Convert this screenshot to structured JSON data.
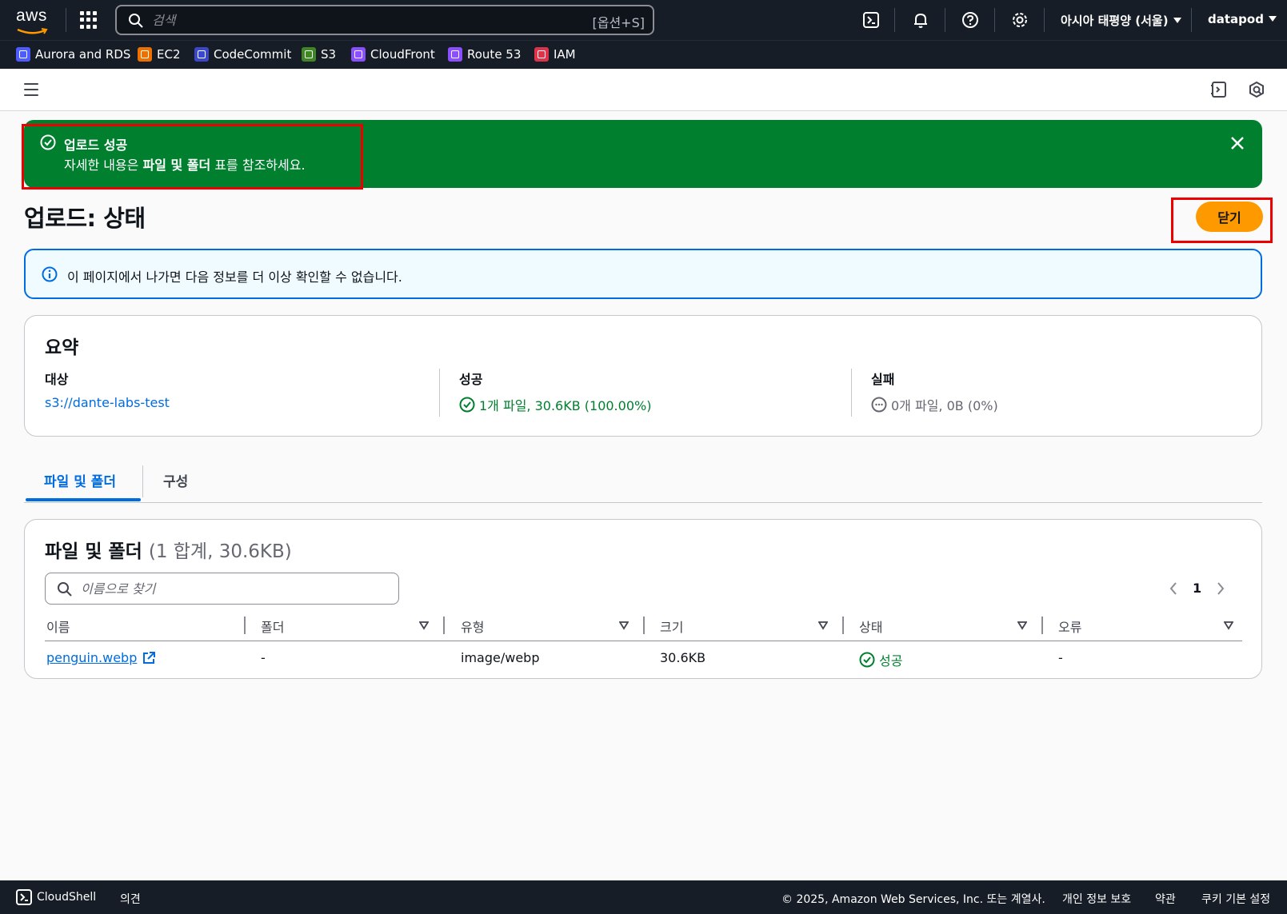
{
  "topnav": {
    "logo_text": "aws",
    "search_placeholder": "검색",
    "search_shortcut": "[옵션+S]",
    "region": "아시아 태평양 (서울)",
    "account": "datapod"
  },
  "favorites": [
    {
      "label": "Aurora and RDS",
      "color": "#4d5cff"
    },
    {
      "label": "EC2",
      "color": "#ed7100"
    },
    {
      "label": "CodeCommit",
      "color": "#3b48cc"
    },
    {
      "label": "S3",
      "color": "#3f8624"
    },
    {
      "label": "CloudFront",
      "color": "#8c4fff"
    },
    {
      "label": "Route 53",
      "color": "#8c4fff"
    },
    {
      "label": "IAM",
      "color": "#dd344c"
    }
  ],
  "flash": {
    "title": "업로드 성공",
    "body_prefix": "자세한 내용은 ",
    "body_bold": "파일 및 폴더",
    "body_suffix": " 표를 참조하세요."
  },
  "page": {
    "title": "업로드: 상태",
    "close_label": "닫기"
  },
  "info_alert": {
    "text": "이 페이지에서 나가면 다음 정보를 더 이상 확인할 수 없습니다."
  },
  "summary": {
    "heading": "요약",
    "destination_label": "대상",
    "destination_value": "s3://dante-labs-test",
    "success_label": "성공",
    "success_value": "1개 파일, 30.6KB (100.00%)",
    "failed_label": "실패",
    "failed_value": "0개 파일, 0B (0%)"
  },
  "tabs": [
    {
      "label": "파일 및 폴더",
      "active": true
    },
    {
      "label": "구성",
      "active": false
    }
  ],
  "files": {
    "heading": "파일 및 폴더",
    "count": "(1 합계, 30.6KB)",
    "search_placeholder": "이름으로 찾기",
    "page": "1",
    "columns": [
      "이름",
      "폴더",
      "유형",
      "크기",
      "상태",
      "오류"
    ],
    "rows": [
      {
        "name": "penguin.webp",
        "folder": "-",
        "type": "image/webp",
        "size": "30.6KB",
        "status": "성공",
        "error": "-"
      }
    ]
  },
  "footer": {
    "cloudshell": "CloudShell",
    "feedback": "의견",
    "copyright": "© 2025, Amazon Web Services, Inc. 또는 계열사.",
    "privacy": "개인 정보 보호",
    "terms": "약관",
    "cookies": "쿠키 기본 설정"
  },
  "colors": {
    "flash_success": "#00802f",
    "primary_button": "#ff9900",
    "link": "#006ce0",
    "nav_bg": "#161d26"
  }
}
